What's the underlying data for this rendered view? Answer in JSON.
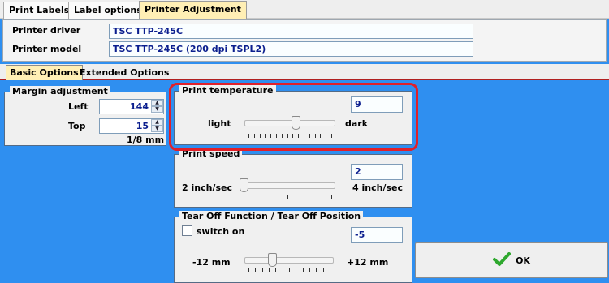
{
  "tabs": [
    {
      "label": "Print Labels"
    },
    {
      "label": "Label options"
    },
    {
      "label": "Printer Adjustment"
    }
  ],
  "printer": {
    "driver_label": "Printer driver",
    "driver_value": "TSC TTP-245C",
    "model_label": "Printer model",
    "model_value": "TSC TTP-245C (200 dpi TSPL2)"
  },
  "option_tabs": [
    {
      "label": "Basic Options"
    },
    {
      "label": "Extended Options"
    }
  ],
  "margin": {
    "title": "Margin adjustment",
    "left_label": "Left",
    "left_value": "144",
    "top_label": "Top",
    "top_value": "15",
    "unit": "1/8 mm"
  },
  "temperature": {
    "title": "Print temperature",
    "value": "9",
    "min_label": "light",
    "max_label": "dark",
    "level_fraction": 0.57
  },
  "speed": {
    "title": "Print speed",
    "value": "2",
    "min_label": "2 inch/sec",
    "max_label": "4 inch/sec",
    "level_fraction": 0.0
  },
  "tearoff": {
    "title": "Tear Off Function / Tear Off Position",
    "switch_label": "switch on",
    "switch_checked": false,
    "value": "-5",
    "min_label": "-12 mm",
    "max_label": "+12 mm",
    "level_fraction": 0.29
  },
  "ok_button": {
    "label": "OK",
    "icon": "checkmark-icon"
  },
  "colors": {
    "background": "#2f8ff0",
    "active_tab": "#ffefb5",
    "value_text": "#0b1e8e",
    "highlight": "#e0202a",
    "ok_check": "#2ea82e"
  }
}
